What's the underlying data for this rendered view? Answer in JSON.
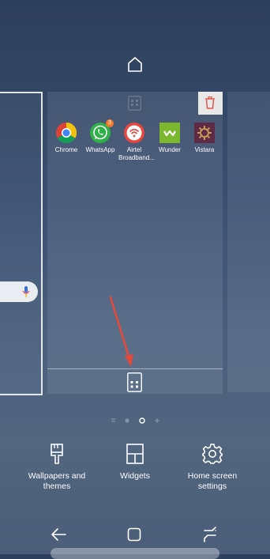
{
  "main_page": {
    "apps": [
      {
        "label": "Chrome",
        "icon": "chrome-icon"
      },
      {
        "label": "WhatsApp",
        "icon": "whatsapp-icon",
        "badge": "3"
      },
      {
        "label": "Airtel Broadband...",
        "icon": "airtel-icon"
      },
      {
        "label": "Wunder",
        "icon": "wunder-icon"
      },
      {
        "label": "Vistara",
        "icon": "vistara-icon"
      }
    ]
  },
  "options": {
    "wallpapers": "Wallpapers and themes",
    "widgets": "Widgets",
    "settings": "Home screen settings"
  },
  "colors": {
    "arrow": "#e24b3b",
    "delete": "#e0564b",
    "background": "#3a4f70"
  }
}
